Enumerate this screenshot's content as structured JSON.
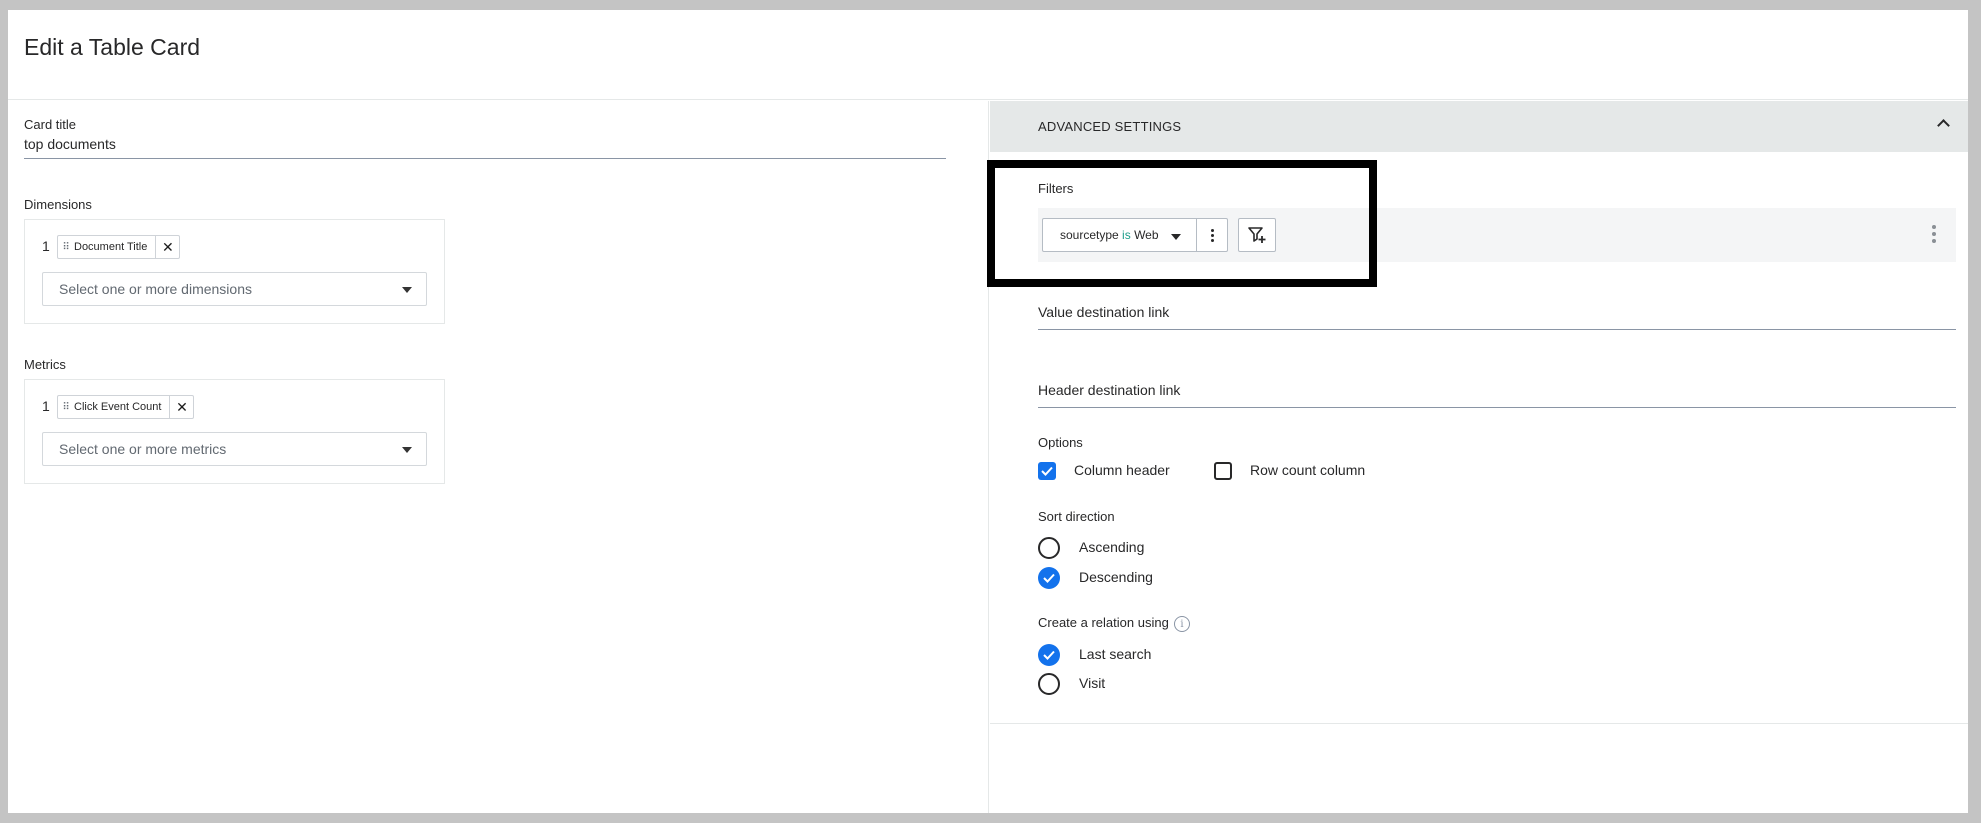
{
  "page": {
    "title": "Edit a Table Card"
  },
  "card_title": {
    "label": "Card title",
    "value": "top documents"
  },
  "dimensions": {
    "label": "Dimensions",
    "items": [
      {
        "index": "1",
        "label": "Document Title"
      }
    ],
    "select_placeholder": "Select one or more dimensions"
  },
  "metrics": {
    "label": "Metrics",
    "items": [
      {
        "index": "1",
        "label": "Click Event Count"
      }
    ],
    "select_placeholder": "Select one or more metrics"
  },
  "advanced": {
    "title": "ADVANCED SETTINGS",
    "filters": {
      "label": "Filters",
      "filter_field": "sourcetype",
      "filter_operator": "is",
      "filter_value": "Web"
    },
    "value_destination_link": {
      "label": "Value destination link"
    },
    "header_destination_link": {
      "label": "Header destination link"
    },
    "options": {
      "label": "Options",
      "column_header": {
        "label": "Column header",
        "checked": true
      },
      "row_count_column": {
        "label": "Row count column",
        "checked": false
      }
    },
    "sort_direction": {
      "label": "Sort direction",
      "ascending": {
        "label": "Ascending",
        "selected": false
      },
      "descending": {
        "label": "Descending",
        "selected": true
      }
    },
    "relation": {
      "label": "Create a relation using",
      "last_search": {
        "label": "Last search",
        "selected": true
      },
      "visit": {
        "label": "Visit",
        "selected": false
      }
    }
  },
  "colors": {
    "accent": "#1372ec",
    "operator": "#1d9e8b",
    "section_bg": "#e5e8e8",
    "highlight": "#000000"
  }
}
